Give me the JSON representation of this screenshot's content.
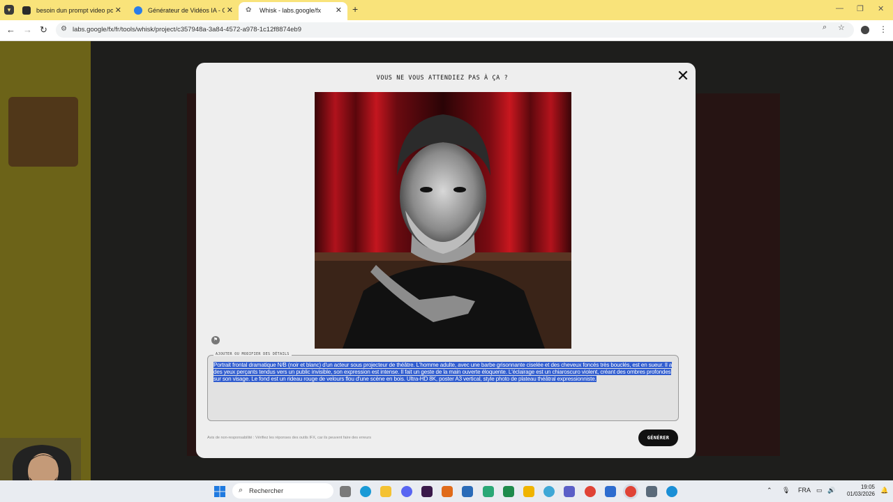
{
  "browser": {
    "tabs": [
      {
        "label": "besoin dun prompt video pour",
        "favicon_color": "#2b2b2b",
        "active": false
      },
      {
        "label": "Générateur de Vidéos IA - Créé",
        "favicon_color": "#2b7de9",
        "active": false
      },
      {
        "label": "Whisk - labs.google/fx",
        "favicon_color": "#888888",
        "active": true
      }
    ],
    "new_tab": "+",
    "url": "labs.google/fx/fr/tools/whisk/project/c357948a-3a84-4572-a978-1c12f8874eb9",
    "chrome_color": "#f9e37a"
  },
  "modal": {
    "title": "VOUS NE VOUS ATTENDIEZ PAS À ÇA ?",
    "close": "✕",
    "prompt_label": "AJOUTER OU MODIFIER DES DÉTAILS",
    "prompt_text": "Portrait frontal dramatique N/B (noir et blanc) d'un acteur sous projecteur de théâtre. L'homme adulte, avec une barbe grisonnante ciselée et des cheveux foncés très bouclés, est en sueur. Il a des yeux perçants tendus vers un public invisible, son expression est intense. Il fait un geste de la main ouverte éloquente. L'éclairage est un chiaroscuro violent, créant des ombres profondes sur son visage. Le fond est un rideau rouge de velours flou d'une scène en bois. Ultra-HD 8K, poster A3 vertical, style photo de plateau théâtral expressionniste.",
    "disclaimer": "Avis de non-responsabilité : Vérifiez les réponses des outils IFX, car ils peuvent faire des erreurs",
    "generate_button": "GÉNÉRER",
    "selection_color": "#2f5ccf"
  },
  "taskbar": {
    "search_placeholder": "Rechercher",
    "language": "FRA",
    "time": "19:05",
    "date": "01/03/2026"
  }
}
